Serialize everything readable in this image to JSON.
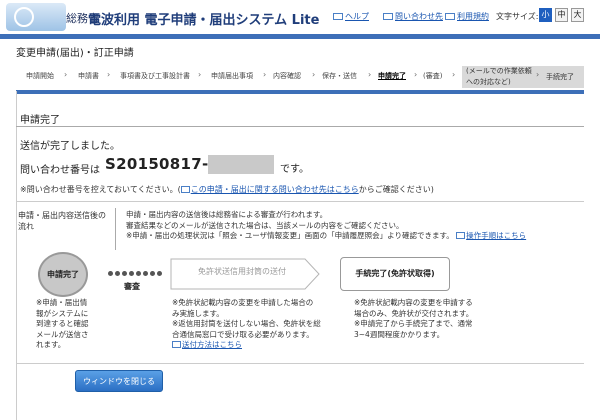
{
  "header": {
    "ministry": "総務省",
    "app_title": "電波利用 電子申請・届出システム Lite",
    "links": {
      "help": "ヘルプ",
      "contact": "問い合わせ先",
      "terms": "利用規約"
    },
    "font_size_label": "文字サイズ:",
    "font_sizes": [
      "小",
      "中",
      "大"
    ],
    "font_size_selected": "小",
    "accent_color": "#3d6fb8"
  },
  "page_title": "変更申請(届出)・訂正申請",
  "steps": {
    "items": [
      "申請開始",
      "申請書",
      "事項書及び工事設計書",
      "申請届出事項",
      "内容確認",
      "保存・送信",
      "申請完了",
      "(審査)"
    ],
    "current": "申請完了",
    "tail_note": "(メールでの作業依頼への対応など)",
    "tail_done": "手続完了"
  },
  "main": {
    "heading": "申請完了",
    "sent_message": "送信が完了しました。",
    "inquiry_label": "問い合わせ番号は",
    "inquiry_number": "S20150817-",
    "inquiry_suffix": "です。",
    "note_prefix": "※問い合わせ番号を控えておいてください。(",
    "note_link": "この申請・届出に関する問い合わせ先はこちら",
    "note_suffix": "からご確認ください)"
  },
  "flow": {
    "label": "申請・届出内容送信後の流れ",
    "desc_line1": "申請・届出内容の送信後は総務省による審査が行われます。",
    "desc_line2": "審査結果などのメールが送信された場合は、当該メールの内容をご確認ください。",
    "desc_line3": "※申請・届出の処理状況は「照会・ユーザ情報変更」画面の「申請履歴照会」より確認できます。",
    "desc_link": "操作手順はこちら",
    "circle_label": "申請完了",
    "review_label": "審査",
    "arrow_label": "免許状送信用封筒の送付",
    "done_label": "手続完了(免許状取得)",
    "col1": [
      "※申請・届出情",
      "報がシステムに",
      "到達すると確認",
      "メールが送信さ",
      "れます。"
    ],
    "col2": [
      "※免許状記載内容の変更を申請した場合の",
      "み実施します。",
      "※返信用封筒を送付しない場合、免許状を総",
      "合通信局窓口で受け取る必要があります。"
    ],
    "col2_link": "送付方法はこちら",
    "col3": [
      "※免許状記載内容の変更を申請する",
      "場合のみ、免許状が交付されます。",
      "※申請完了から手続完了まで、通常",
      "3~4週間程度かかります。"
    ]
  },
  "close_button": "ウィンドウを閉じる"
}
